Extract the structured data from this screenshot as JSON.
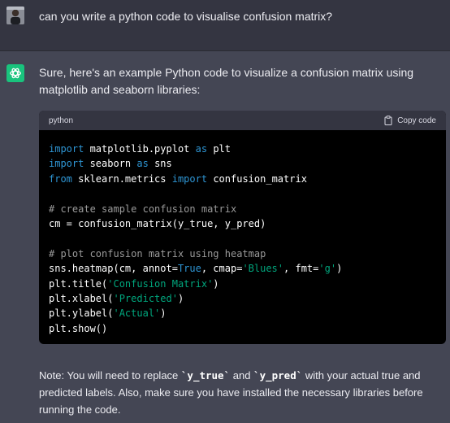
{
  "user_message": {
    "text": "can you write a python code to visualise confusion matrix?"
  },
  "assistant": {
    "intro": "Sure, here's an example Python code to visualize a confusion matrix using matplotlib and seaborn libraries:",
    "code_block": {
      "language": "python",
      "copy_label": "Copy code",
      "lines": {
        "l1_kw": "import",
        "l1_rest": " matplotlib.pyplot ",
        "l1_kw2": "as",
        "l1_end": " plt",
        "l2_kw": "import",
        "l2_rest": " seaborn ",
        "l2_kw2": "as",
        "l2_end": " sns",
        "l3_kw": "from",
        "l3_rest": " sklearn.metrics ",
        "l3_kw2": "import",
        "l3_end": " confusion_matrix",
        "l5": "# create sample confusion matrix",
        "l6": "cm = confusion_matrix(y_true, y_pred)",
        "l8": "# plot confusion matrix using heatmap",
        "l9_a": "sns.heatmap(cm, annot=",
        "l9_b": "True",
        "l9_c": ", cmap=",
        "l9_d": "'Blues'",
        "l9_e": ", fmt=",
        "l9_f": "'g'",
        "l9_g": ")",
        "l10_a": "plt.title(",
        "l10_b": "'Confusion Matrix'",
        "l10_c": ")",
        "l11_a": "plt.xlabel(",
        "l11_b": "'Predicted'",
        "l11_c": ")",
        "l12_a": "plt.ylabel(",
        "l12_b": "'Actual'",
        "l12_c": ")",
        "l13": "plt.show()"
      }
    },
    "note": {
      "p1": "Note: You will need to replace ",
      "c1": "`y_true`",
      "p2": " and ",
      "c2": "`y_pred`",
      "p3": " with your actual true and predicted labels. Also, make sure you have installed the necessary libraries before running the code."
    }
  },
  "colors": {
    "user_bg": "#343541",
    "assistant_bg": "#444654",
    "code_bg": "#000000",
    "keyword": "#2e95d3",
    "string": "#00a67d",
    "comment": "#9a9a9a",
    "logo": "#19c37d"
  },
  "icons": {
    "user_avatar": "user-avatar-photo",
    "assistant_logo": "openai-logo-icon",
    "copy": "clipboard-icon"
  }
}
